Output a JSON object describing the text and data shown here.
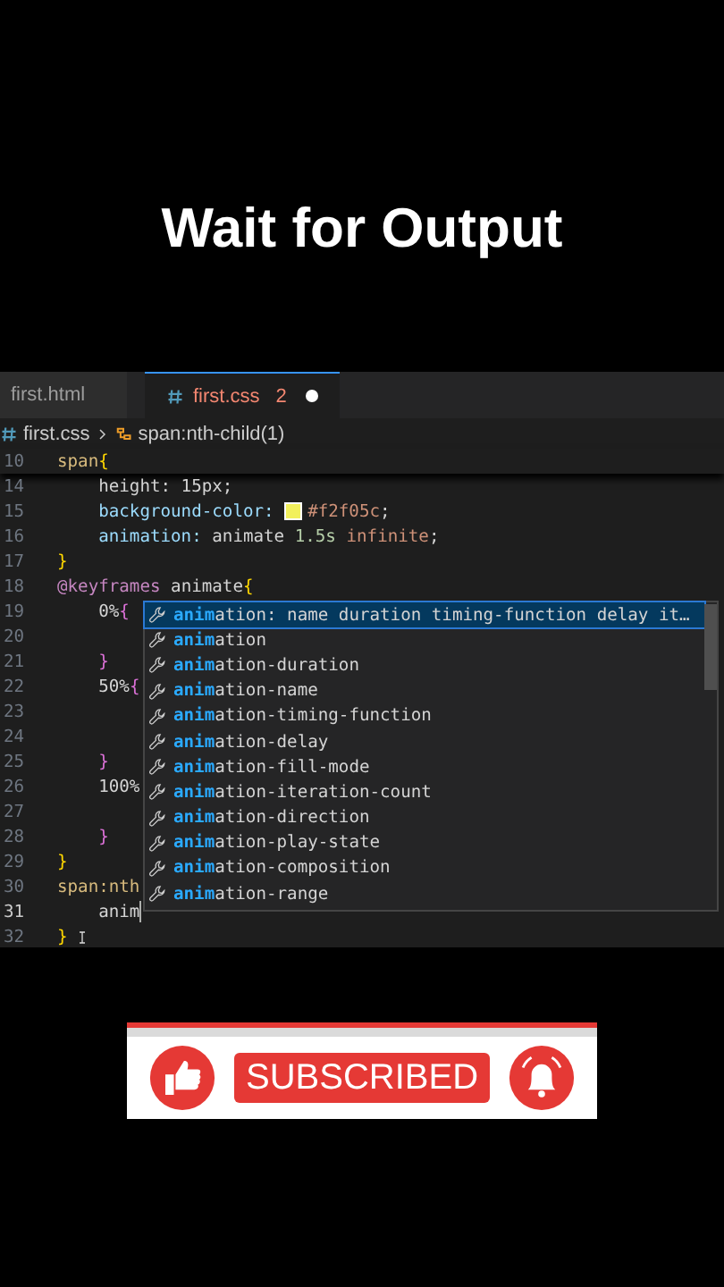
{
  "heading": "Wait for Output",
  "tabs": [
    {
      "label": "first.html",
      "selected": false,
      "modified": false
    },
    {
      "label": "first.css",
      "selected": true,
      "problems": "2",
      "modified": true
    }
  ],
  "breadcrumb": {
    "file": "first.css",
    "symbol": "span:nth-child(1)"
  },
  "sticky_line": {
    "number": "10",
    "tokens": [
      {
        "text": "span",
        "kind": "sel"
      },
      {
        "text": "{",
        "kind": "brace1"
      }
    ]
  },
  "lines": [
    {
      "number": "14",
      "current": false,
      "tokens": [
        {
          "text": "    height: 15px;",
          "kind": "plain"
        }
      ]
    },
    {
      "number": "15",
      "current": false,
      "tokens": [
        {
          "text": "    background-color: ",
          "kind": "prop"
        },
        {
          "kind": "swatch",
          "color": "#f2f05c"
        },
        {
          "text": "#f2f05c",
          "kind": "val"
        },
        {
          "text": ";",
          "kind": "plain"
        }
      ]
    },
    {
      "number": "16",
      "current": false,
      "tokens": [
        {
          "text": "    animation: ",
          "kind": "prop"
        },
        {
          "text": "animate ",
          "kind": "plain"
        },
        {
          "text": "1.5s ",
          "kind": "num"
        },
        {
          "text": "infinite",
          "kind": "val"
        },
        {
          "text": ";",
          "kind": "plain"
        }
      ]
    },
    {
      "number": "17",
      "current": false,
      "tokens": [
        {
          "text": "}",
          "kind": "brace1"
        }
      ]
    },
    {
      "number": "18",
      "current": false,
      "tokens": [
        {
          "text": "@keyframes ",
          "kind": "kw"
        },
        {
          "text": "animate",
          "kind": "plain"
        },
        {
          "text": "{",
          "kind": "brace1"
        }
      ]
    },
    {
      "number": "19",
      "current": false,
      "tokens": [
        {
          "text": "    0%",
          "kind": "plain"
        },
        {
          "text": "{",
          "kind": "brace2"
        }
      ]
    },
    {
      "number": "20",
      "current": false
    },
    {
      "number": "21",
      "current": false,
      "tokens": [
        {
          "text": "    }",
          "kind": "brace2"
        }
      ]
    },
    {
      "number": "22",
      "current": false,
      "tokens": [
        {
          "text": "    50%",
          "kind": "plain"
        },
        {
          "text": "{",
          "kind": "brace2"
        }
      ]
    },
    {
      "number": "23",
      "current": false
    },
    {
      "number": "24",
      "current": false
    },
    {
      "number": "25",
      "current": false,
      "tokens": [
        {
          "text": "    }",
          "kind": "brace2"
        }
      ]
    },
    {
      "number": "26",
      "current": false,
      "tokens": [
        {
          "text": "    100%",
          "kind": "plain"
        }
      ]
    },
    {
      "number": "27",
      "current": false
    },
    {
      "number": "28",
      "current": false,
      "tokens": [
        {
          "text": "    }",
          "kind": "brace2"
        }
      ]
    },
    {
      "number": "29",
      "current": false,
      "tokens": [
        {
          "text": "}",
          "kind": "brace1"
        }
      ]
    },
    {
      "number": "30",
      "current": false,
      "tokens": [
        {
          "text": "span:nth",
          "kind": "sel"
        }
      ]
    },
    {
      "number": "31",
      "current": true,
      "tokens": [
        {
          "text": "    anim",
          "kind": "plain"
        }
      ]
    },
    {
      "number": "32",
      "current": false,
      "tokens": [
        {
          "text": "}",
          "kind": "brace1"
        }
      ]
    }
  ],
  "suggestions": [
    {
      "match": "anim",
      "rest": "ation: name duration timing-function delay it…",
      "selected": true
    },
    {
      "match": "anim",
      "rest": "ation",
      "selected": false
    },
    {
      "match": "anim",
      "rest": "ation-duration",
      "selected": false
    },
    {
      "match": "anim",
      "rest": "ation-name",
      "selected": false
    },
    {
      "match": "anim",
      "rest": "ation-timing-function",
      "selected": false
    },
    {
      "match": "anim",
      "rest": "ation-delay",
      "selected": false
    },
    {
      "match": "anim",
      "rest": "ation-fill-mode",
      "selected": false
    },
    {
      "match": "anim",
      "rest": "ation-iteration-count",
      "selected": false
    },
    {
      "match": "anim",
      "rest": "ation-direction",
      "selected": false
    },
    {
      "match": "anim",
      "rest": "ation-play-state",
      "selected": false
    },
    {
      "match": "anim",
      "rest": "ation-composition",
      "selected": false
    },
    {
      "match": "anim",
      "rest": "ation-range",
      "selected": false
    }
  ],
  "banner": {
    "button": "SUBSCRIBED"
  }
}
